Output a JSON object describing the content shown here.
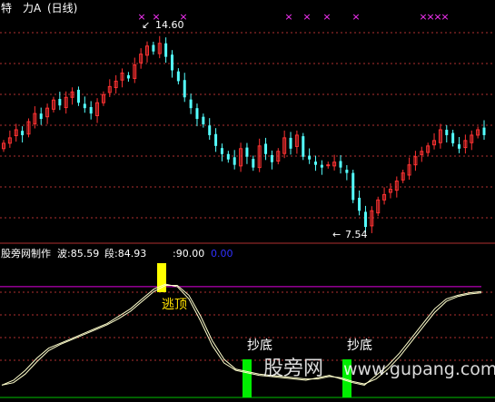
{
  "header": {
    "stock_name": "特　力A",
    "period": "(日线)"
  },
  "main_chart": {
    "high_marker": "14.60",
    "low_marker": "7.54",
    "pink_marks": [
      "×",
      "×",
      "×",
      "×",
      "×",
      "×",
      "×",
      "×",
      "×",
      "×",
      "×"
    ]
  },
  "indicator": {
    "name": "股旁网制作",
    "label_bo": "波:85.59",
    "label_duan": "段:84.93",
    "label_90": ":90.00",
    "label_0": "0.00",
    "escape_label": "逃顶",
    "buy_label_1": "抄底",
    "buy_label_2": "抄底"
  },
  "watermark": {
    "cn": "股旁网",
    "url": "www.gupang.com"
  },
  "colors": {
    "up": "#ff3232",
    "down": "#54ffff",
    "grid": "#b03030",
    "curve": "#ffffcc",
    "line90": "#e000e0",
    "line0": "#00c000",
    "escape": "#ffff00",
    "buy": "#00ee00",
    "mark": "#ff33ff",
    "label_yellow": "#ffe000",
    "label_zero": "#3030ff"
  },
  "chart_data": [
    {
      "type": "candlestick",
      "title": "特 力A (日线)",
      "price_range": [
        7.2,
        15.4
      ],
      "annotations": [
        {
          "text": "14.60",
          "value": 14.6
        },
        {
          "text": "7.54",
          "value": 7.54
        }
      ],
      "closes": [
        10.7,
        10.9,
        11.2,
        11.0,
        11.5,
        11.8,
        11.6,
        12.0,
        12.3,
        12.1,
        12.4,
        12.6,
        12.2,
        12.0,
        11.8,
        12.2,
        12.5,
        12.8,
        13.0,
        13.3,
        13.1,
        13.6,
        14.0,
        14.3,
        14.1,
        14.4,
        13.9,
        13.4,
        13.0,
        12.4,
        12.0,
        11.6,
        11.4,
        11.0,
        10.6,
        10.3,
        10.1,
        9.9,
        10.5,
        10.2,
        9.8,
        10.6,
        10.3,
        10.0,
        10.4,
        10.9,
        10.5,
        11.0,
        10.2,
        10.1,
        9.9,
        9.8,
        9.9,
        10.0,
        9.8,
        9.6,
        8.6,
        8.2,
        7.6,
        8.2,
        8.6,
        8.8,
        9.0,
        9.3,
        9.6,
        9.9,
        10.2,
        10.4,
        10.6,
        10.8,
        11.2,
        11.0,
        10.7,
        10.5,
        10.8,
        11.0,
        11.2,
        11.0
      ]
    },
    {
      "type": "line",
      "title": "股旁网制作",
      "ylim": [
        0,
        100
      ],
      "reference_lines": [
        {
          "name": "90.00",
          "value": 90
        },
        {
          "name": "0.00",
          "value": 0
        }
      ],
      "series": [
        {
          "name": "波",
          "last": 85.59,
          "values": [
            10,
            14,
            22,
            32,
            40,
            44,
            48,
            52,
            56,
            60,
            66,
            72,
            80,
            88,
            92,
            90,
            80,
            62,
            42,
            28,
            22,
            20,
            18,
            17,
            16,
            15,
            14,
            16,
            18,
            15,
            12,
            10,
            18,
            26,
            36,
            48,
            60,
            72,
            80,
            83,
            85,
            86
          ]
        },
        {
          "name": "段",
          "last": 84.93,
          "values": [
            10,
            12,
            19,
            29,
            38,
            43,
            47,
            51,
            55,
            59,
            64,
            70,
            78,
            86,
            91,
            91,
            83,
            66,
            46,
            31,
            23,
            21,
            19,
            18,
            17,
            16,
            15,
            15,
            17,
            16,
            13,
            11,
            15,
            23,
            33,
            45,
            57,
            69,
            78,
            82,
            84,
            85
          ]
        }
      ],
      "signals": [
        {
          "label": "逃顶",
          "type": "escape",
          "index": 14
        },
        {
          "label": "抄底",
          "type": "buy",
          "index": 22
        },
        {
          "label": "抄底",
          "type": "buy",
          "index": 30
        }
      ]
    }
  ]
}
